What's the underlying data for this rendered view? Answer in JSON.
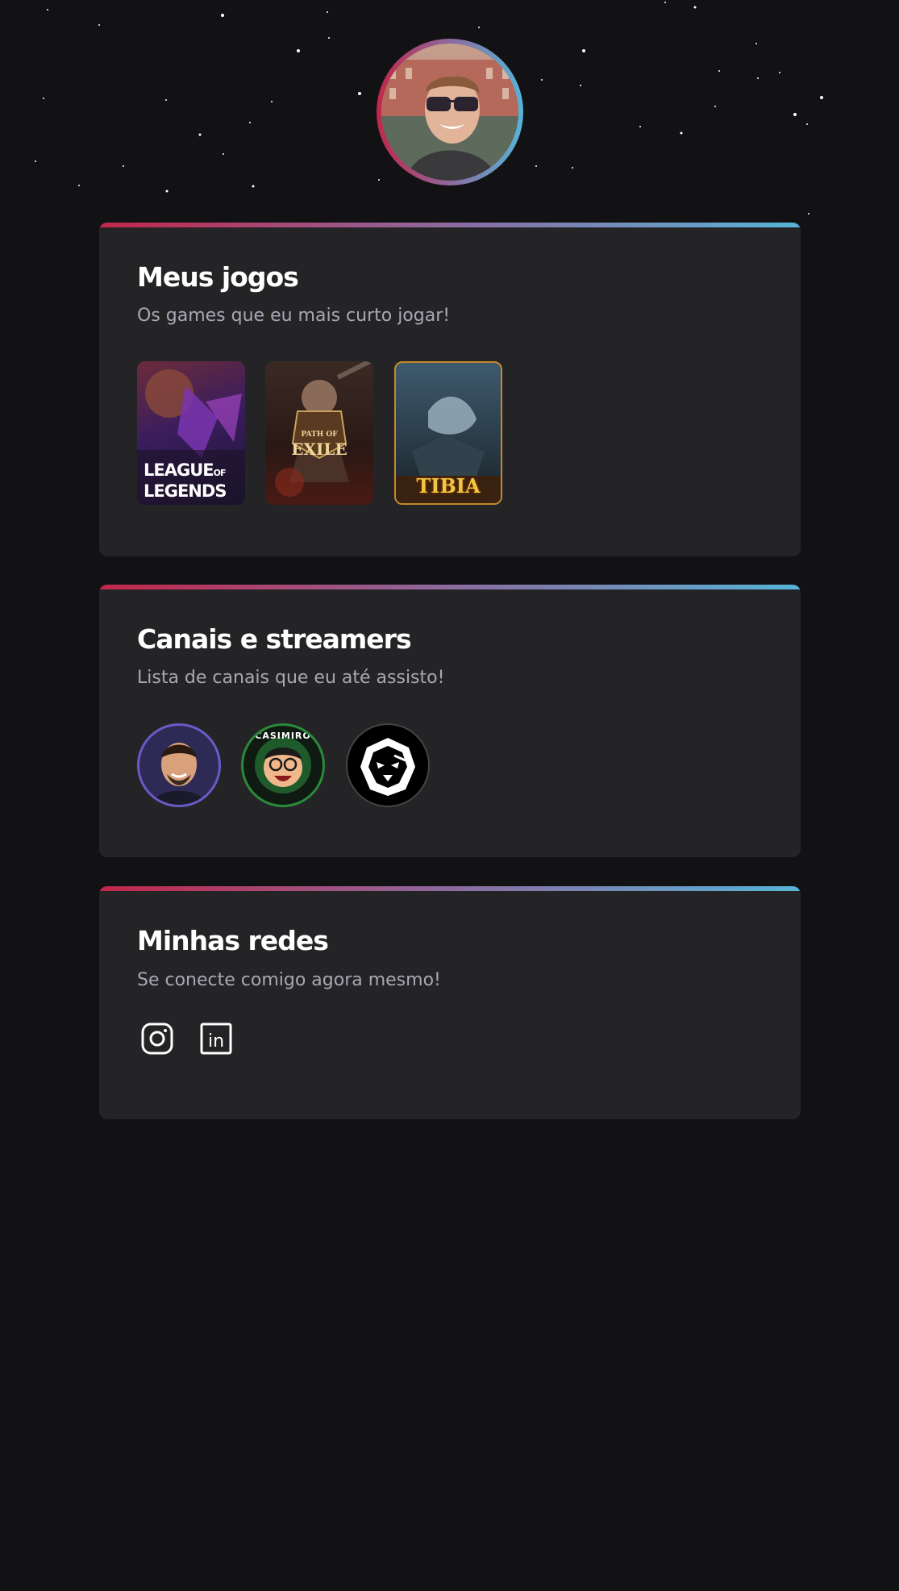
{
  "profile": {
    "avatar_alt": "Foto de perfil"
  },
  "games": {
    "title": "Meus jogos",
    "subtitle": "Os games que eu mais curto jogar!",
    "items": [
      {
        "name": "League of Legends",
        "line1": "LEAGUE",
        "line1b": "OF",
        "line2": "LEGENDS"
      },
      {
        "name": "Path of Exile",
        "line1": "PATH",
        "line1b": "OF",
        "line2": "EXILE"
      },
      {
        "name": "Tibia",
        "line1": "TIBIA"
      }
    ]
  },
  "channels": {
    "title": "Canais e streamers",
    "subtitle": "Lista de canais que eu até assisto!",
    "items": [
      {
        "name": "Streamer 1"
      },
      {
        "name": "Casimiro",
        "badge": "CASIMIRO"
      },
      {
        "name": "Lion channel"
      }
    ]
  },
  "socials": {
    "title": "Minhas redes",
    "subtitle": "Se conecte comigo agora mesmo!",
    "items": [
      {
        "name": "instagram-icon"
      },
      {
        "name": "linkedin-icon",
        "glyph": "in"
      }
    ]
  },
  "colors": {
    "background": "#121214",
    "card": "#242427",
    "gradient_start": "#c2264a",
    "gradient_end": "#56b4d8",
    "title": "#ffffff",
    "subtitle": "#a8a8b3"
  }
}
